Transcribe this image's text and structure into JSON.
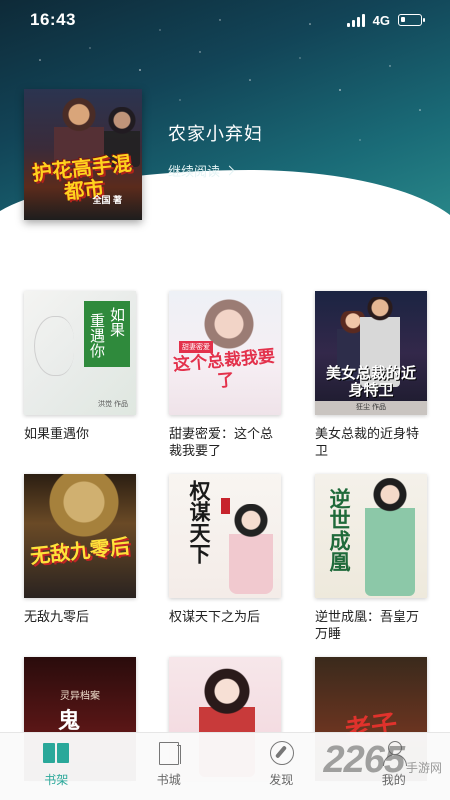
{
  "status_bar": {
    "time": "16:43",
    "network": "4G"
  },
  "hero": {
    "cover_title": "护花高手混都市",
    "cover_author": "全国 著",
    "title": "农家小弃妇",
    "continue_label": "继续阅读"
  },
  "books": [
    {
      "title": "如果重遇你",
      "cover_text_a": "如果",
      "cover_text_b": "重遇你",
      "cover_author": "洪觉 作品"
    },
    {
      "title": "甜妻密爱：这个总裁我要了",
      "cover_tag": "甜妻密爱",
      "cover_text": "这个总裁我要了"
    },
    {
      "title": "美女总裁的近身特卫",
      "cover_text": "美女总裁的近身特卫",
      "cover_author": "狂尘 作品"
    },
    {
      "title": "无敌九零后",
      "cover_text": "无敌九零后"
    },
    {
      "title": "权谋天下之为后",
      "cover_text": "权谋天下"
    },
    {
      "title": "逆世成凰：吾皇万万睡",
      "cover_text": "逆世成凰"
    },
    {
      "title": "",
      "cover_text": "灵异档案",
      "cover_ghost": "鬼"
    },
    {
      "title": ""
    },
    {
      "title": "",
      "cover_text": "老子"
    }
  ],
  "tabbar": {
    "items": [
      {
        "label": "书架",
        "icon": "bookshelf-icon",
        "active": true
      },
      {
        "label": "书城",
        "icon": "bookstore-icon",
        "active": false
      },
      {
        "label": "发现",
        "icon": "compass-icon",
        "active": false
      },
      {
        "label": "我的",
        "icon": "user-icon",
        "active": false
      }
    ]
  },
  "watermark": {
    "number": "2265",
    "text": "手游网"
  },
  "colors": {
    "accent": "#2aa89a",
    "header_dark": "#124457"
  }
}
